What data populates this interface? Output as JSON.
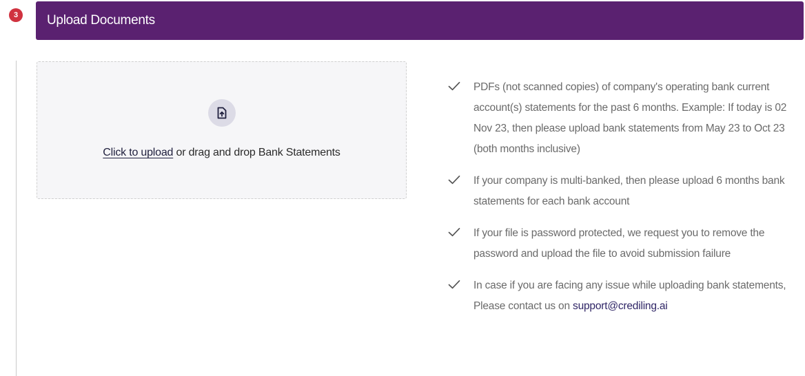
{
  "step": {
    "number": "3",
    "title": "Upload Documents"
  },
  "upload": {
    "link_text": "Click to upload",
    "rest_text": " or drag and drop Bank Statements",
    "icon": "file-upload-icon"
  },
  "checklist": [
    "PDFs (not scanned copies) of company's operating bank current account(s) statements for the past 6 months. Example: If today is 02 Nov 23, then please upload bank statements from May 23 to Oct 23 (both months inclusive)",
    "If your company is multi-banked, then please upload 6 months bank statements for each bank account",
    "If your file is password protected, we request you to remove the password and upload the file to avoid submission failure"
  ],
  "contact": {
    "text": "In case if you are facing any issue while uploading bank statements, Please contact us on ",
    "email": "support@crediling.ai"
  },
  "colors": {
    "header_bg": "#5a2170",
    "badge_bg": "#d0323f",
    "email_link": "#2f2566"
  }
}
